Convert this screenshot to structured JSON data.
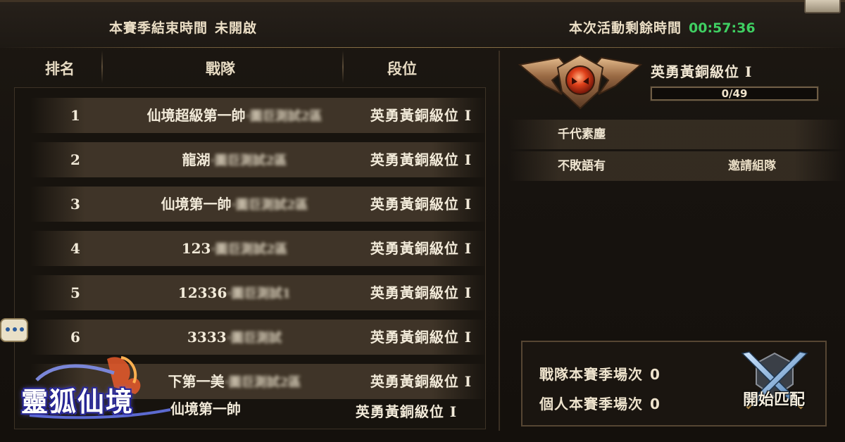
{
  "header": {
    "season_end_label": "本賽季結束時間",
    "season_end_value": "未開啟",
    "event_remain_label": "本次活動剩餘時間",
    "event_remain_value": "00:57:36",
    "timer_color": "#3fcf62"
  },
  "ranking": {
    "columns": [
      "排名",
      "戰隊",
      "段位"
    ],
    "rows": [
      {
        "rank": "1",
        "team": "仙境超級第一帥",
        "team_hidden": "·圖巨測試2區",
        "tier": "英勇黃銅級位 I"
      },
      {
        "rank": "2",
        "team": "龍湖",
        "team_hidden": "·圖巨測試2區",
        "tier": "英勇黃銅級位 I"
      },
      {
        "rank": "3",
        "team": "仙境第一帥",
        "team_hidden": "·圖巨測試2區",
        "tier": "英勇黃銅級位 I"
      },
      {
        "rank": "4",
        "team": "123",
        "team_hidden": "·圖巨測試2區",
        "tier": "英勇黃銅級位 I"
      },
      {
        "rank": "5",
        "team": "12336",
        "team_hidden": "·圖巨測試1",
        "tier": "英勇黃銅級位 I"
      },
      {
        "rank": "6",
        "team": "3333",
        "team_hidden": "·圖巨測試",
        "tier": "英勇黃銅級位 I"
      },
      {
        "rank": "",
        "team": "下第一美",
        "team_hidden": "·圖巨測試2區",
        "tier": "英勇黃銅級位 I"
      }
    ],
    "my_team": {
      "team": "仙境第一帥",
      "tier": "英勇黃銅級位 I"
    }
  },
  "my_rank": {
    "tier_name": "英勇黃銅級位 I",
    "progress_text": "0/49",
    "progress_fraction": 0,
    "emblem_icon": "bronze-tier-emblem-icon"
  },
  "members": [
    {
      "name": "千代素塵",
      "action": ""
    },
    {
      "name": "不敗語有",
      "action": "邀請組隊"
    }
  ],
  "stats": {
    "team_matches_label": "戰隊本賽季場次",
    "team_matches_value": "0",
    "personal_matches_label": "個人本賽季場次",
    "personal_matches_value": "0"
  },
  "match_button": {
    "label": "開始匹配",
    "icon": "crossed-swords-icon"
  },
  "chat_icon": "chat-bubble-icon",
  "logo": {
    "text": "靈狐仙境"
  }
}
